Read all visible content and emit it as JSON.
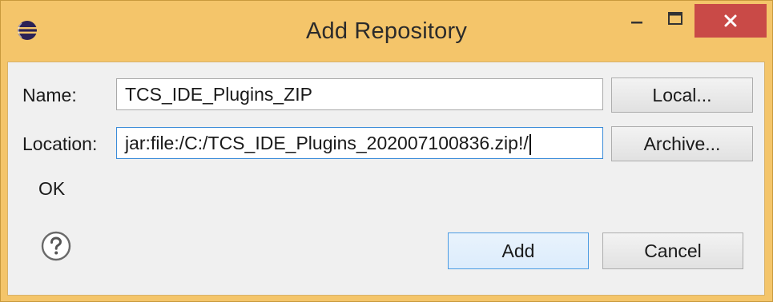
{
  "window": {
    "title": "Add Repository"
  },
  "form": {
    "name_label": "Name:",
    "name_value": "TCS_IDE_Plugins_ZIP",
    "location_label": "Location:",
    "location_value": "jar:file:/C:/TCS_IDE_Plugins_202007100836.zip!/",
    "status_text": "OK"
  },
  "buttons": {
    "local": "Local...",
    "archive": "Archive...",
    "add": "Add",
    "cancel": "Cancel"
  },
  "icons": {
    "app": "eclipse-icon",
    "help": "help-icon",
    "minimize": "minimize-icon",
    "maximize": "maximize-icon",
    "close": "close-icon"
  },
  "colors": {
    "title_bar": "#f4c56a",
    "close_button": "#c94a47",
    "client_bg": "#f0f0f0",
    "focus_border": "#3c8cd9",
    "default_button_border": "#4b9be3"
  }
}
